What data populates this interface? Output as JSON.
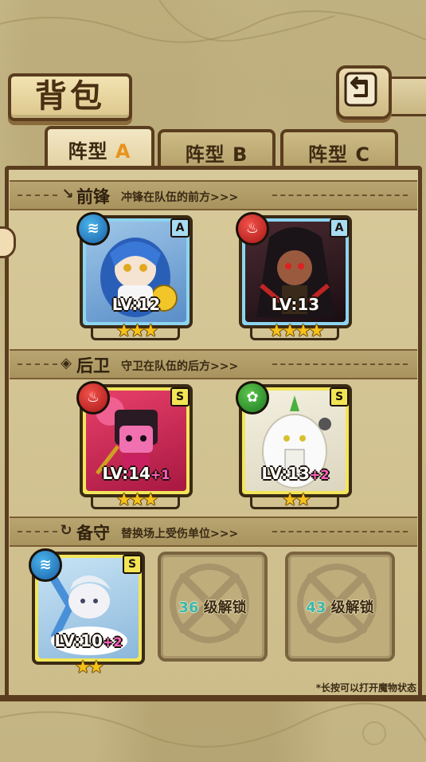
{
  "header": {
    "title": "背包"
  },
  "tabs": [
    {
      "prefix": "阵型",
      "letter": "A",
      "active": true
    },
    {
      "prefix": "阵型",
      "letter": "B",
      "active": false
    },
    {
      "prefix": "阵型",
      "letter": "C",
      "active": false
    }
  ],
  "sections": {
    "front": {
      "title": "前锋",
      "desc": "冲锋在队伍的前方>>>"
    },
    "back": {
      "title": "后卫",
      "desc": "守卫在队伍的后方>>>"
    },
    "reserve": {
      "title": "备守",
      "desc": "替换场上受伤单位>>>"
    }
  },
  "cards": {
    "front1": {
      "element": "water",
      "rank": "A",
      "level": "LV:12",
      "plus": "",
      "stars": "★★★"
    },
    "front2": {
      "element": "fire",
      "rank": "A",
      "level": "LV:13",
      "plus": "",
      "stars": "★★★★"
    },
    "back1": {
      "element": "fire",
      "rank": "S",
      "level": "LV:14",
      "plus": "+1",
      "stars": "★★★"
    },
    "back2": {
      "element": "leaf",
      "rank": "S",
      "level": "LV:13",
      "plus": "+2",
      "stars": "★★"
    },
    "reserve1": {
      "element": "water",
      "rank": "S",
      "level": "LV:10",
      "plus": "+2",
      "stars": "★★"
    }
  },
  "locked": [
    {
      "level": "36",
      "text": "级解锁"
    },
    {
      "level": "43",
      "text": "级解锁"
    }
  ],
  "hint": "*长按可以打开魔物状态",
  "colors": {
    "panel_border": "#5a3d1e",
    "gold_frame": "#f2e65a",
    "blue_frame": "#8cd4f0",
    "active_letter": "#e8921c"
  }
}
